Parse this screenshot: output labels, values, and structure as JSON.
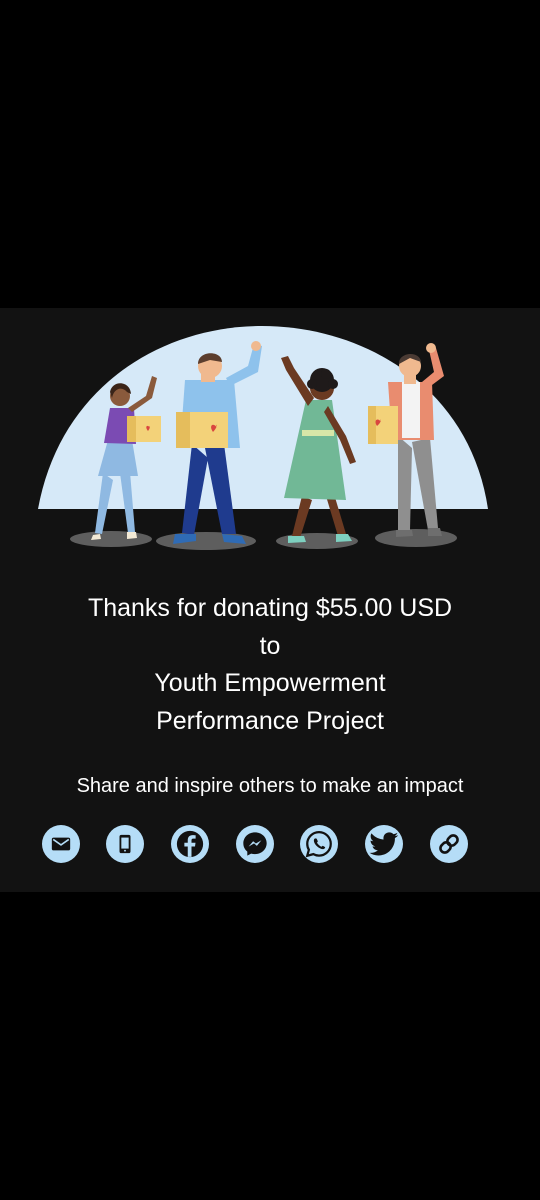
{
  "confirmation": {
    "line1": "Thanks for donating $55.00 USD",
    "line2": "to",
    "line3": "Youth Empowerment",
    "line4": "Performance Project"
  },
  "share": {
    "prompt": "Share and inspire others to make an impact",
    "buttons": [
      {
        "name": "email",
        "icon": "envelope-icon"
      },
      {
        "name": "sms",
        "icon": "mobile-phone-icon"
      },
      {
        "name": "facebook",
        "icon": "facebook-icon"
      },
      {
        "name": "messenger",
        "icon": "messenger-icon"
      },
      {
        "name": "whatsapp",
        "icon": "whatsapp-icon"
      },
      {
        "name": "twitter",
        "icon": "twitter-icon"
      },
      {
        "name": "copy-link",
        "icon": "link-icon"
      }
    ]
  },
  "colors": {
    "page_background": "#000000",
    "card_background": "#121212",
    "icon_circle": "#b5ddf7",
    "icon_glyph": "#121212",
    "text": "#ffffff",
    "illustration_sky": "#d6e9f8"
  }
}
